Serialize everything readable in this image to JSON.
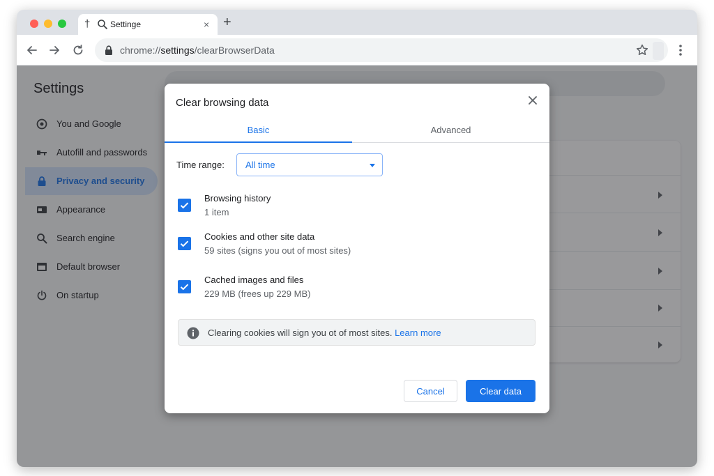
{
  "browser": {
    "tab": {
      "title": "Settinge",
      "close": "×"
    },
    "new_tab": "+",
    "address": {
      "scheme": "chrome://",
      "host": "settings",
      "path": "/clearBrowserData"
    }
  },
  "settings": {
    "title": "Settings",
    "sidebar": [
      {
        "label": "You and Google",
        "icon": "google-icon",
        "active": false
      },
      {
        "label": "Autofill and passwords",
        "icon": "key-icon",
        "active": false
      },
      {
        "label": "Privacy and security",
        "icon": "lock-icon",
        "active": true
      },
      {
        "label": "Appearance",
        "icon": "palette-icon",
        "active": false
      },
      {
        "label": "Search engine",
        "icon": "search-icon",
        "active": false
      },
      {
        "label": "Default browser",
        "icon": "browser-window-icon",
        "active": false
      },
      {
        "label": "On startup",
        "icon": "power-icon",
        "active": false
      }
    ]
  },
  "dialog": {
    "title": "Clear browsing data",
    "tabs": {
      "basic": "Basic",
      "advanced": "Advanced",
      "selected": "basic"
    },
    "time_range": {
      "label": "Time range:",
      "value": "All time"
    },
    "options": [
      {
        "title": "Browsing history",
        "subtitle": "1 item",
        "checked": true
      },
      {
        "title": "Cookies and other site data",
        "subtitle": "59 sites (signs you out of most sites)",
        "checked": true
      },
      {
        "title": "Cached images and files",
        "subtitle": "229 MB (frees up 229 MB)",
        "checked": true
      }
    ],
    "info": {
      "text": "Clearing cookies will sign you ot of most sites.",
      "link": "Learn more"
    },
    "buttons": {
      "cancel": "Cancel",
      "clear": "Clear data"
    }
  },
  "colors": {
    "accent": "#1a73e8",
    "active_nav_bg": "#d2e3fc",
    "overlay": "rgba(32,33,36,0.46)"
  }
}
